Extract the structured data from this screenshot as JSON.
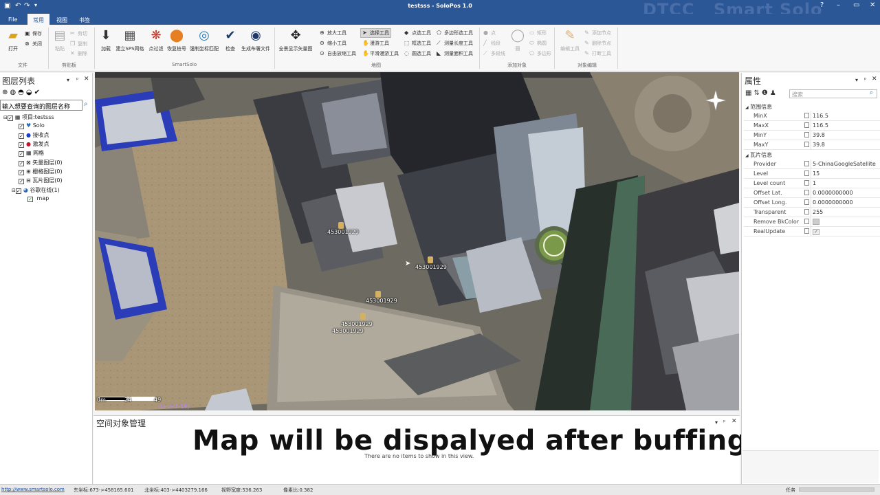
{
  "window": {
    "title": "testsss - SoloPos 1.0",
    "brand_logo": "DTCC",
    "brand_product": "Smart Solo",
    "controls": [
      "?",
      "–",
      "▭",
      "✕"
    ]
  },
  "tabs": [
    "File",
    "常用",
    "视图",
    "书签"
  ],
  "active_tab": "常用",
  "ribbon": {
    "file_group": {
      "label": "文件",
      "open": "打开",
      "save": "保存",
      "close": "关闭"
    },
    "clipboard_group": {
      "label": "剪贴板",
      "paste": "粘贴",
      "cut": "剪切",
      "copy": "复制",
      "delete": "删除"
    },
    "smartsolo_group": {
      "label": "SmartSolo",
      "buttons": [
        "加载",
        "建立SPS网格",
        "点过滤",
        "恢复桩号",
        "强制坐标匹配",
        "检查",
        "生成布署文件"
      ]
    },
    "map_group": {
      "label": "地图",
      "fullscreen": "全景显示矢量图",
      "col1": [
        "放大工具",
        "缩小工具",
        "自由放缩工具"
      ],
      "col2": [
        "选择工具",
        "漫游工具",
        "平滑漫游工具"
      ],
      "col3": [
        "点选工具",
        "框选工具",
        "圆选工具"
      ],
      "col4": [
        "多边形选工具",
        "测量长度工具",
        "测量面积工具"
      ]
    },
    "add_object_group": {
      "label": "添加对象",
      "col1": [
        "点",
        "线段",
        "多段线"
      ],
      "circle": "圆",
      "col2": [
        "矩形",
        "椭圆",
        "多边形"
      ]
    },
    "edit_object_group": {
      "label": "对象编辑",
      "edit_tool": "编辑工具",
      "col": [
        "添加节点",
        "删除节点",
        "打断工具"
      ]
    }
  },
  "layer_panel": {
    "title": "图层列表",
    "search_placeholder": "输入想要查询的图层名称",
    "project": "项目:testsss",
    "items": [
      "Solo",
      "接收点",
      "激发点",
      "网格",
      "矢量图层(0)",
      "栅格图层(0)",
      "瓦片图层(0)"
    ],
    "online": "谷歌在线(1)",
    "map": "map"
  },
  "map": {
    "markers": [
      {
        "label": "453001929"
      },
      {
        "label": "453001929"
      },
      {
        "label": "453001929"
      },
      {
        "label": "453001929"
      },
      {
        "label": "453001929"
      }
    ],
    "scale_labels": [
      "0m",
      "24",
      "49"
    ],
    "level_label": "(Level1:18)"
  },
  "bottom_panel": {
    "title": "空间对象管理",
    "empty": "There are no items to show in this view.",
    "overlay": "Map will be dispalyed after buffing"
  },
  "properties": {
    "title": "属性",
    "search_placeholder": "搜索",
    "cat1": "范围信息",
    "rows1": [
      {
        "k": "MinX",
        "v": "116.5"
      },
      {
        "k": "MaxX",
        "v": "116.5"
      },
      {
        "k": "MinY",
        "v": "39.8"
      },
      {
        "k": "MaxY",
        "v": "39.8"
      }
    ],
    "cat2": "瓦片信息",
    "rows2": [
      {
        "k": "Provider",
        "v": "5-ChinaGoogleSatellite"
      },
      {
        "k": "Level",
        "v": "15"
      },
      {
        "k": "Level count",
        "v": "1"
      },
      {
        "k": "Offset Lat.",
        "v": "0.0000000000"
      },
      {
        "k": "Offset Long.",
        "v": "0.0000000000"
      },
      {
        "k": "Transparent",
        "v": "255"
      },
      {
        "k": "Remove BkColor",
        "v": ""
      },
      {
        "k": "RealUpdate",
        "v": ""
      }
    ]
  },
  "status": {
    "url": "http://www.smartsolo.com",
    "east": "东坐标:673->458165.601",
    "north": "北坐标:403->4403279.166",
    "width": "视野宽度:536.263",
    "ratio": "像素比:0.382",
    "task": "任务"
  }
}
